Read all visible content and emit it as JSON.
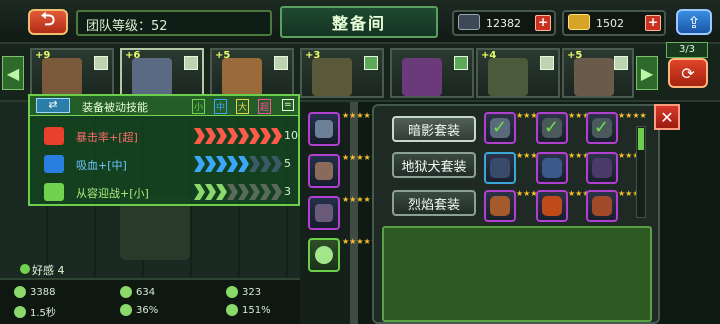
{
  "header": {
    "title": "整备间",
    "team_level_label": "团队等级：52",
    "currency1": "12382",
    "currency2": "1502",
    "plus": "+"
  },
  "heroes": [
    {
      "plus": "+9"
    },
    {
      "plus": "+6"
    },
    {
      "plus": "+5"
    },
    {
      "plus": "+3"
    },
    {
      "plus": ""
    },
    {
      "plus": "+4"
    },
    {
      "plus": "+5"
    }
  ],
  "hero_count": "3/3",
  "skill_panel": {
    "title": "装备被动技能",
    "levels": [
      "小",
      "中",
      "大",
      "超"
    ],
    "level_colors": [
      "#6fd34f",
      "#3aa7f8",
      "#f2d04a",
      "#ff4fa0"
    ],
    "rows": [
      {
        "name": "暴击率+[超]",
        "value": "10",
        "name_color": "#ff6a6a",
        "chev_colors": [
          "#ff5a4a",
          "#ff5a4a",
          "#ff5a4a",
          "#ff5a4a",
          "#ff5a4a",
          "#ff5a4a",
          "#ff5a4a",
          "#ff5a4a"
        ]
      },
      {
        "name": "吸血+[中]",
        "value": "5",
        "name_color": "#6ec7ff",
        "chev_colors": [
          "#3aa7f8",
          "#3aa7f8",
          "#3aa7f8",
          "#3aa7f8",
          "#3aa7f8",
          "#3a5a6a",
          "#3a5a6a",
          "#3a5a6a"
        ]
      },
      {
        "name": "从容迎战+[小]",
        "value": "3",
        "name_color": "#a8f07a",
        "chev_colors": [
          "#8ad96a",
          "#8ad96a",
          "#8ad96a",
          "#5a6a5a",
          "#5a6a5a",
          "#5a6a5a",
          "#5a6a5a",
          "#5a6a5a"
        ]
      }
    ]
  },
  "favor": "好感 4",
  "stats": {
    "hp": "3388",
    "attack": "634",
    "defense": "323",
    "speed": "1.5秒",
    "crit": "36%",
    "crit_dmg": "151%"
  },
  "suits": [
    "暗影套装",
    "地狱犬套装",
    "烈焰套装"
  ]
}
